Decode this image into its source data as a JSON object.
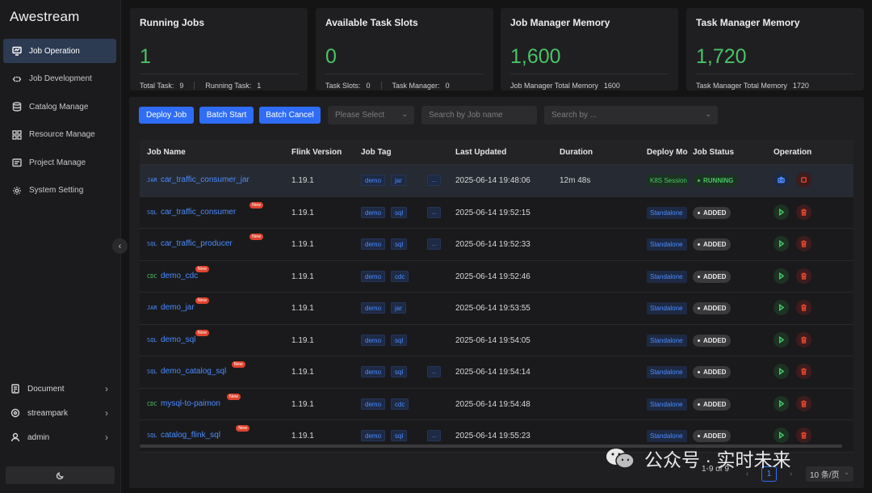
{
  "app": {
    "title": "Awestream"
  },
  "sidebar": {
    "items": [
      {
        "label": "Job Operation",
        "icon": "monitor-icon",
        "active": true
      },
      {
        "label": "Job Development",
        "icon": "code-icon"
      },
      {
        "label": "Catalog Manage",
        "icon": "database-icon"
      },
      {
        "label": "Resource Manage",
        "icon": "grid-icon"
      },
      {
        "label": "Project Manage",
        "icon": "folder-icon"
      },
      {
        "label": "System Setting",
        "icon": "gear-icon"
      }
    ],
    "bottom": [
      {
        "label": "Document",
        "icon": "document-icon"
      },
      {
        "label": "streampark",
        "icon": "team-icon"
      },
      {
        "label": "admin",
        "icon": "user-icon"
      }
    ]
  },
  "stats": {
    "running": {
      "title": "Running Jobs",
      "value": "1",
      "label1": "Total Task:",
      "value1": "9",
      "label2": "Running Task:",
      "value2": "1"
    },
    "slots": {
      "title": "Available Task Slots",
      "value": "0",
      "label1": "Task Slots:",
      "value1": "0",
      "label2": "Task Manager:",
      "value2": "0"
    },
    "jm": {
      "title": "Job Manager Memory",
      "value": "1,600",
      "label1": "Job Manager Total Memory",
      "value1": "1600"
    },
    "tm": {
      "title": "Task Manager Memory",
      "value": "1,720",
      "label1": "Task Manager Total Memory",
      "value1": "1720"
    }
  },
  "toolbar": {
    "deploy": "Deploy Job",
    "batch_start": "Batch Start",
    "batch_cancel": "Batch Cancel",
    "select_placeholder": "Please Select",
    "search_name_placeholder": "Search by Job name",
    "search_by_placeholder": "Search by ..."
  },
  "table": {
    "headers": {
      "name": "Job Name",
      "flink": "Flink Version",
      "tag": "Job Tag",
      "updated": "Last Updated",
      "duration": "Duration",
      "deploy": "Deploy Mo",
      "status": "Job Status",
      "operation": "Operation"
    },
    "rows": [
      {
        "type": "JAR",
        "name": "car_traffic_consumer_jar",
        "isNew": false,
        "flink": "1.19.1",
        "tags": [
          "demo",
          "jar"
        ],
        "more": "...",
        "updated": "2025-06-14 19:48:06",
        "duration": "12m 48s",
        "mode": "K8S Session",
        "modeKind": "k8s",
        "status": "RUNNING",
        "statusKind": "running"
      },
      {
        "type": "SQL",
        "name": "car_traffic_consumer",
        "isNew": true,
        "flink": "1.19.1",
        "tags": [
          "demo",
          "sql"
        ],
        "more": "...",
        "updated": "2025-06-14 19:52:15",
        "duration": "",
        "mode": "Standalone",
        "modeKind": "std",
        "status": "ADDED",
        "statusKind": "added"
      },
      {
        "type": "SQL",
        "name": "car_traffic_producer",
        "isNew": true,
        "flink": "1.19.1",
        "tags": [
          "demo",
          "sql"
        ],
        "more": "...",
        "updated": "2025-06-14 19:52:33",
        "duration": "",
        "mode": "Standalone",
        "modeKind": "std",
        "status": "ADDED",
        "statusKind": "added"
      },
      {
        "type": "CDC",
        "name": "demo_cdc",
        "isNew": true,
        "flink": "1.19.1",
        "tags": [
          "demo",
          "cdc"
        ],
        "more": "",
        "updated": "2025-06-14 19:52:46",
        "duration": "",
        "mode": "Standalone",
        "modeKind": "std",
        "status": "ADDED",
        "statusKind": "added"
      },
      {
        "type": "JAR",
        "name": "demo_jar",
        "isNew": true,
        "flink": "1.19.1",
        "tags": [
          "demo",
          "jar"
        ],
        "more": "",
        "updated": "2025-06-14 19:53:55",
        "duration": "",
        "mode": "Standalone",
        "modeKind": "std",
        "status": "ADDED",
        "statusKind": "added"
      },
      {
        "type": "SQL",
        "name": "demo_sql",
        "isNew": true,
        "flink": "1.19.1",
        "tags": [
          "demo",
          "sql"
        ],
        "more": "",
        "updated": "2025-06-14 19:54:05",
        "duration": "",
        "mode": "Standalone",
        "modeKind": "std",
        "status": "ADDED",
        "statusKind": "added"
      },
      {
        "type": "SQL",
        "name": "demo_catalog_sql",
        "isNew": true,
        "flink": "1.19.1",
        "tags": [
          "demo",
          "sql"
        ],
        "more": "...",
        "updated": "2025-06-14 19:54:14",
        "duration": "",
        "mode": "Standalone",
        "modeKind": "std",
        "status": "ADDED",
        "statusKind": "added"
      },
      {
        "type": "CDC",
        "name": "mysql-to-paimon",
        "isNew": true,
        "flink": "1.19.1",
        "tags": [
          "demo",
          "cdc"
        ],
        "more": "",
        "updated": "2025-06-14 19:54:48",
        "duration": "",
        "mode": "Standalone",
        "modeKind": "std",
        "status": "ADDED",
        "statusKind": "added"
      },
      {
        "type": "SQL",
        "name": "catalog_flink_sql",
        "isNew": true,
        "flink": "1.19.1",
        "tags": [
          "demo",
          "sql"
        ],
        "more": "...",
        "updated": "2025-06-14 19:55:23",
        "duration": "",
        "mode": "Standalone",
        "modeKind": "std",
        "status": "ADDED",
        "statusKind": "added"
      }
    ],
    "new_label": "New"
  },
  "pagination": {
    "summary": "1-9 of 9",
    "current": "1",
    "page_size": "10 条/页"
  },
  "watermark": {
    "text": "公众号 · 实时未来"
  },
  "colors": {
    "accent": "#2f6df6",
    "success": "#49c465",
    "danger": "#e0442e",
    "sql": "#4a8cff",
    "cdc": "#49c465",
    "jar": "#4a8cff"
  }
}
